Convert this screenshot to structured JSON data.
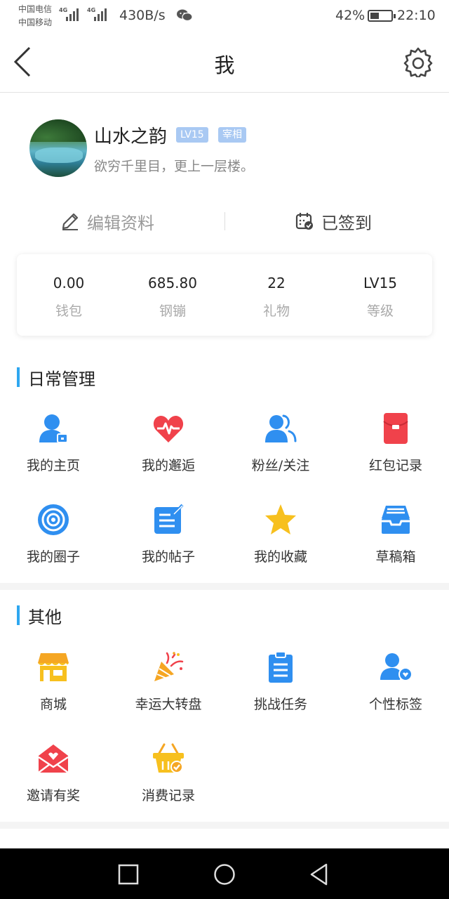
{
  "status_bar": {
    "carrier_1": "中国电信",
    "carrier_2": "中国移动",
    "net_tag_1": "4G",
    "net_tag_2": "4G",
    "net_speed": "430B/s",
    "battery_percent": "42%",
    "battery_level": 0.42,
    "time": "22:10"
  },
  "header": {
    "title": "我"
  },
  "profile": {
    "username": "山水之韵",
    "level_badge": "LV15",
    "title_badge": "宰相",
    "signature": "欲穷千里目，更上一层楼。"
  },
  "actions": {
    "edit_label": "编辑资料",
    "checkin_label": "已签到"
  },
  "stats": [
    {
      "value": "0.00",
      "label": "钱包"
    },
    {
      "value": "685.80",
      "label": "钢镚"
    },
    {
      "value": "22",
      "label": "礼物"
    },
    {
      "value": "LV15",
      "label": "等级"
    }
  ],
  "daily": {
    "title": "日常管理",
    "items": [
      {
        "label": "我的主页",
        "icon": "user-home-icon"
      },
      {
        "label": "我的邂逅",
        "icon": "heart-pulse-icon"
      },
      {
        "label": "粉丝/关注",
        "icon": "fans-icon"
      },
      {
        "label": "红包记录",
        "icon": "red-packet-icon"
      },
      {
        "label": "我的圈子",
        "icon": "circle-target-icon"
      },
      {
        "label": "我的帖子",
        "icon": "post-edit-icon"
      },
      {
        "label": "我的收藏",
        "icon": "star-icon"
      },
      {
        "label": "草稿箱",
        "icon": "drafts-box-icon"
      }
    ]
  },
  "other": {
    "title": "其他",
    "items": [
      {
        "label": "商城",
        "icon": "shop-icon"
      },
      {
        "label": "幸运大转盘",
        "icon": "party-popper-icon"
      },
      {
        "label": "挑战任务",
        "icon": "clipboard-icon"
      },
      {
        "label": "个性标签",
        "icon": "user-tag-icon"
      },
      {
        "label": "邀请有奖",
        "icon": "invite-envelope-icon"
      },
      {
        "label": "消费记录",
        "icon": "basket-icon"
      }
    ]
  },
  "colors": {
    "accent": "#2ea7f0",
    "icon_blue": "#2f8ff0",
    "icon_red": "#f0424b",
    "icon_yellow": "#f7c01e",
    "icon_orange": "#f5a623",
    "badge": "#a9c9f3"
  }
}
